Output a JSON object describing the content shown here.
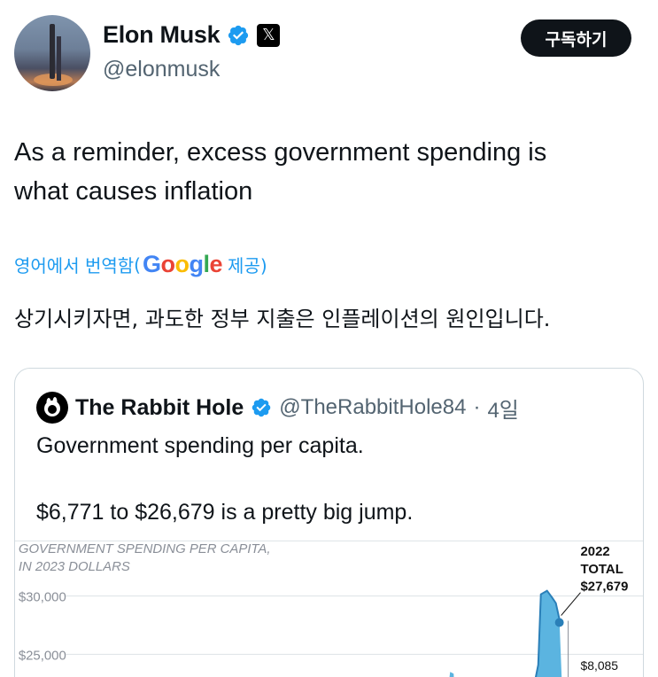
{
  "author": {
    "display_name": "Elon Musk",
    "handle": "@elonmusk",
    "affiliation_badge": "𝕏"
  },
  "subscribe_button": "구독하기",
  "tweet_text_line1": "As a reminder, excess government spending is",
  "tweet_text_line2": "what causes inflation",
  "translation": {
    "prefix": "영어에서 번역함",
    "open_paren": "(",
    "google": [
      "G",
      "o",
      "o",
      "g",
      "l",
      "e"
    ],
    "suffix": "제공)",
    "text": "상기시키자면, 과도한 정부 지출은 인플레이션의 원인입니다."
  },
  "quote": {
    "name": "The Rabbit Hole",
    "handle": "@TheRabbitHole84",
    "separator": "·",
    "time": "4일",
    "text1": "Government spending per capita.",
    "text2": "$6,771 to $26,679 is a pretty big jump."
  },
  "chart_data": {
    "type": "area",
    "title_line1": "GOVERNMENT SPENDING PER CAPITA,",
    "title_line2": "IN 2023 DOLLARS",
    "y_ticks": [
      "$30,000",
      "$25,000"
    ],
    "y_tick_values": [
      30000,
      25000
    ],
    "annotation_year": "2022",
    "annotation_total_label": "TOTAL",
    "annotation_total_value": "$27,679",
    "annotation_side_value": "$8,085",
    "colors": {
      "fill": "#5bb4e0",
      "stroke": "#2a7fb8",
      "grid": "#dde2e6",
      "title": "#8a8f98",
      "text": "#111111"
    }
  }
}
